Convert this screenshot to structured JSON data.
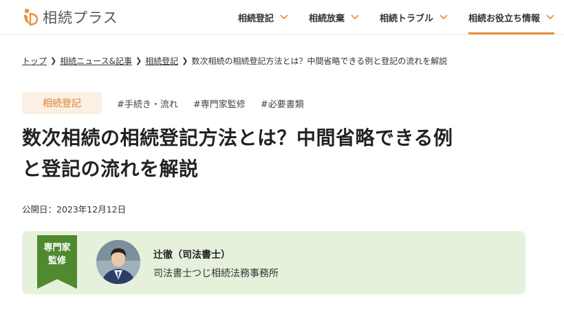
{
  "header": {
    "logo_text": "相続プラス",
    "nav": [
      {
        "label": "相続登記",
        "active": false
      },
      {
        "label": "相続放棄",
        "active": false
      },
      {
        "label": "相続トラブル",
        "active": false
      },
      {
        "label": "相続お役立ち情報",
        "active": true
      }
    ]
  },
  "breadcrumb": [
    {
      "label": "トップ",
      "link": true
    },
    {
      "label": "相続ニュース&記事",
      "link": true
    },
    {
      "label": "相続登記",
      "link": true
    },
    {
      "label": "数次相続の相続登記方法とは？中間省略できる例と登記の流れを解説",
      "link": false
    }
  ],
  "article": {
    "category": "相続登記",
    "tags": [
      "#手続き・流れ",
      "#専門家監修",
      "#必要書類"
    ],
    "title_line1": "数次相続の相続登記方法とは？中間省略できる例",
    "title_line2": "と登記の流れを解説",
    "published": "公開日：2023年12月12日"
  },
  "supervisor": {
    "ribbon_line1": "専門家",
    "ribbon_line2": "監修",
    "name": "辻徹（司法書士）",
    "office": "司法書士つじ相続法務事務所"
  },
  "colors": {
    "accent": "#e8913a",
    "category_bg": "#fcefe3",
    "category_text": "#d9822b",
    "supervisor_bg": "#e6f1dc",
    "ribbon": "#4f8a2f"
  }
}
